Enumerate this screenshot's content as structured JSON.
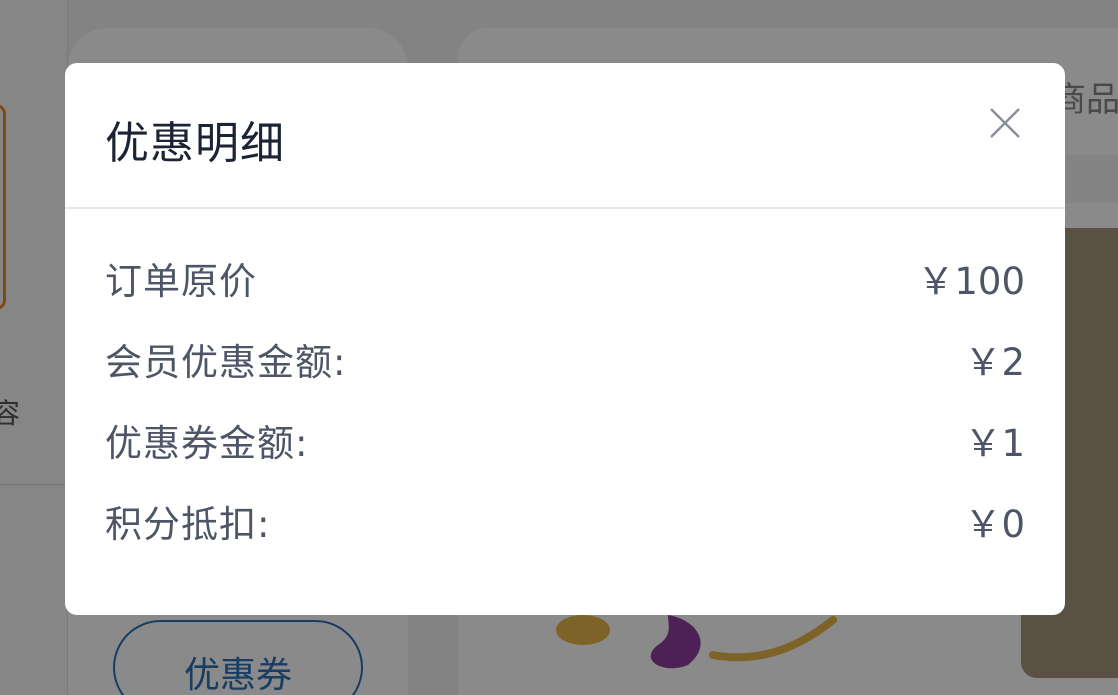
{
  "background": {
    "left_panel_text": "容",
    "coupon_button_label": "优惠券",
    "header_text": "商品"
  },
  "modal": {
    "title": "优惠明细",
    "rows": [
      {
        "label": "订单原价",
        "value": "￥100"
      },
      {
        "label": "会员优惠金额:",
        "value": "￥2"
      },
      {
        "label": "优惠券金额:",
        "value": "￥1"
      },
      {
        "label": "积分抵扣:",
        "value": "￥0"
      }
    ]
  },
  "icons": {
    "close": "close-icon"
  },
  "colors": {
    "accent_blue": "#2f6fb5",
    "accent_orange": "#e8892a",
    "title_text": "#1c2334",
    "body_text": "#4d5566"
  }
}
